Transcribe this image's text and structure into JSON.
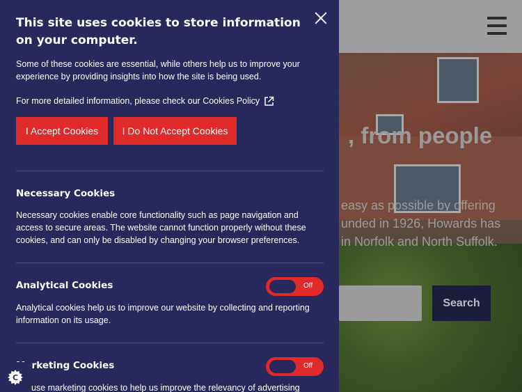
{
  "site": {
    "hero_heading": ", from people",
    "hero_text_lines": [
      "easy as possible by offering",
      "unded in 1926, Howards has",
      "in Norfolk and North Suffolk."
    ],
    "search_button": "Search",
    "menu_icon": "hamburger-icon"
  },
  "cookie_panel": {
    "title": "This site uses cookies to store information on your computer.",
    "intro": "Some of these cookies are essential, while others help us to improve your experience by providing insights into how the site is being used.",
    "policy_text": "For more detailed information, please check our Cookies Policy",
    "policy_icon": "external-link-icon",
    "close_icon": "close-icon",
    "accept_label": "I Accept Cookies",
    "decline_label": "I Do Not Accept Cookies",
    "sections": [
      {
        "title": "Necessary Cookies",
        "text": "Necessary cookies enable core functionality such as page navigation and access to secure areas. The website cannot function properly without these cookies, and can only be disabled by changing your browser preferences."
      },
      {
        "title": "Analytical Cookies",
        "text": "Analytical cookies help us to improve our website by collecting and reporting information on its usage.",
        "toggle_label": "Off"
      },
      {
        "title": "Marketing Cookies",
        "text": "We use marketing cookies to help us improve the relevancy of advertising",
        "toggle_label": "Off"
      }
    ],
    "badge_icon": "cookie-icon"
  },
  "colors": {
    "panel_bg": "#28285c",
    "accent_red": "#e02a2a",
    "search_button_bg": "#1c1d3d"
  }
}
